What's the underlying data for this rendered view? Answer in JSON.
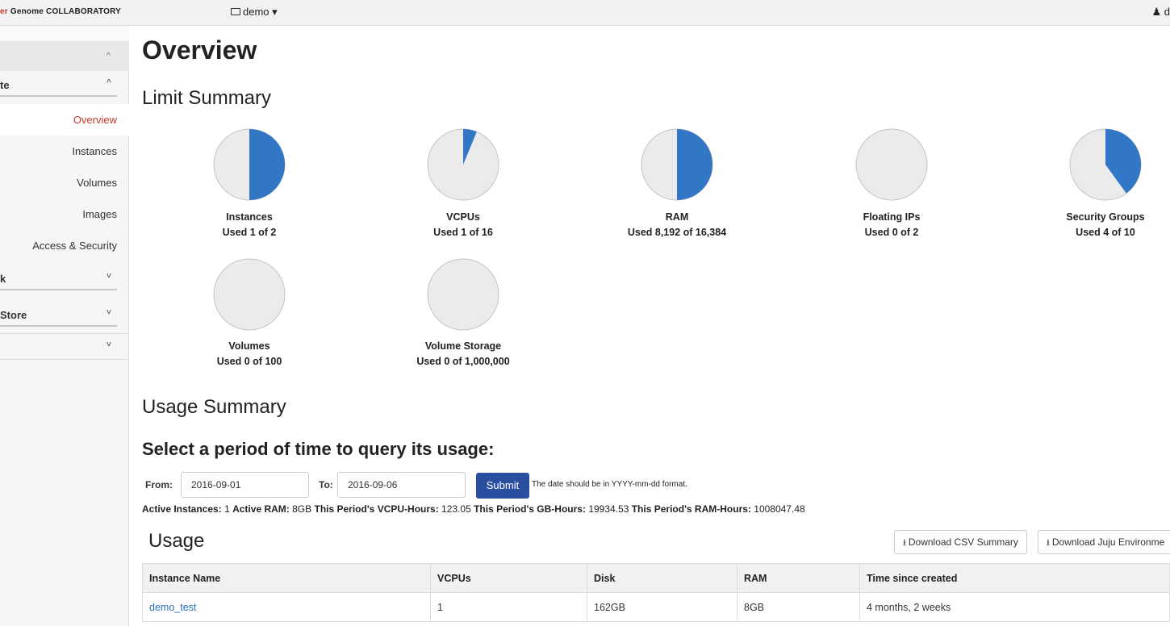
{
  "navbar": {
    "brand_accent": "er",
    "brand_rest": " Genome COLLABORATORY",
    "project": "demo",
    "user_partial": "d"
  },
  "sidebar": {
    "categories": [
      {
        "label": "te",
        "chevron": "^"
      },
      {
        "label": "k",
        "chevron": "˅"
      },
      {
        "label": "Store",
        "chevron": "˅"
      },
      {
        "label": "",
        "chevron": "˅"
      }
    ],
    "section_chevron": "^",
    "items": [
      {
        "label": "Overview",
        "active": true
      },
      {
        "label": "Instances",
        "active": false
      },
      {
        "label": "Volumes",
        "active": false
      },
      {
        "label": "Images",
        "active": false
      },
      {
        "label": "Access & Security",
        "active": false
      }
    ]
  },
  "main": {
    "title": "Overview",
    "limit_summary": "Limit Summary",
    "usage_summary": "Usage Summary",
    "query_heading": "Select a period of time to query its usage:",
    "from_label": "From:",
    "from_value": "2016-09-01",
    "to_label": "To:",
    "to_value": "2016-09-06",
    "submit": "Submit",
    "hint": "The date should be in YYYY-mm-dd format.",
    "stats": [
      {
        "label": "Active Instances:",
        "value": "1"
      },
      {
        "label": "Active RAM:",
        "value": "8GB"
      },
      {
        "label": "This Period's VCPU-Hours:",
        "value": "123.05"
      },
      {
        "label": "This Period's GB-Hours:",
        "value": "19934.53"
      },
      {
        "label": "This Period's RAM-Hours:",
        "value": "1008047.48"
      }
    ],
    "usage_title": "Usage",
    "download_csv": "Download CSV Summary",
    "download_juju": "Download Juju Environme"
  },
  "limits": [
    {
      "name": "Instances",
      "used_text": "Used 1 of 2",
      "used": 1,
      "total": 2
    },
    {
      "name": "VCPUs",
      "used_text": "Used 1 of 16",
      "used": 1,
      "total": 16
    },
    {
      "name": "RAM",
      "used_text": "Used 8,192 of 16,384",
      "used": 8192,
      "total": 16384
    },
    {
      "name": "Floating IPs",
      "used_text": "Used 0 of 2",
      "used": 0,
      "total": 2
    },
    {
      "name": "Security Groups",
      "used_text": "Used 4 of 10",
      "used": 4,
      "total": 10
    },
    {
      "name": "Volumes",
      "used_text": "Used 0 of 100",
      "used": 0,
      "total": 100
    },
    {
      "name": "Volume Storage",
      "used_text": "Used 0 of 1,000,000",
      "used": 0,
      "total": 1000000
    }
  ],
  "table": {
    "headers": [
      "Instance Name",
      "VCPUs",
      "Disk",
      "RAM",
      "Time since created"
    ],
    "rows": [
      [
        "demo_test",
        "1",
        "162GB",
        "8GB",
        "4 months, 2 weeks"
      ]
    ]
  },
  "colors": {
    "pie_used": "#3277c6",
    "pie_empty": "#ebebeb",
    "active_link": "#c0392b",
    "submit_bg": "#2a4f9e"
  }
}
